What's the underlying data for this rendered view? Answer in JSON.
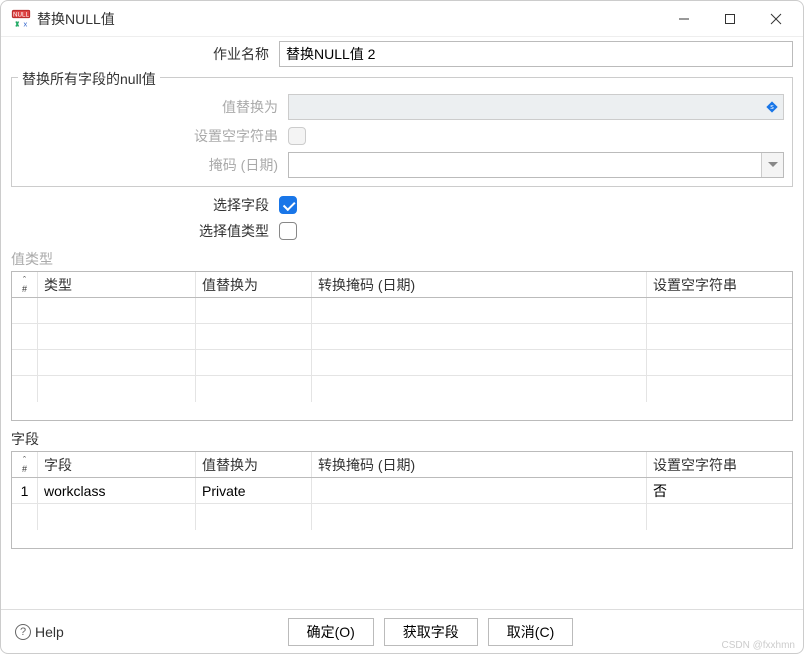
{
  "window": {
    "title": "替换NULL值"
  },
  "form": {
    "job_name_label": "作业名称",
    "job_name_value": "替换NULL值 2"
  },
  "fieldset": {
    "legend": "替换所有字段的null值",
    "replace_value_label": "值替换为",
    "replace_value_value": "",
    "set_empty_string_label": "设置空字符串",
    "date_mask_label": "掩码 (日期)",
    "date_mask_value": ""
  },
  "options": {
    "select_field_label": "选择字段",
    "select_field_checked": true,
    "select_value_type_label": "选择值类型",
    "select_value_type_checked": false
  },
  "value_type_section": {
    "label": "值类型",
    "headers": {
      "hash": "#",
      "type": "类型",
      "replace_as": "值替换为",
      "date_mask": "转换掩码 (日期)",
      "set_empty": "设置空字符串"
    },
    "rows": []
  },
  "field_section": {
    "label": "字段",
    "headers": {
      "hash": "#",
      "field": "字段",
      "replace_as": "值替换为",
      "date_mask": "转换掩码 (日期)",
      "set_empty": "设置空字符串"
    },
    "rows": [
      {
        "num": "1",
        "field": "workclass",
        "replace_as": "Private",
        "date_mask": "",
        "set_empty": "否"
      }
    ]
  },
  "buttons": {
    "help": "Help",
    "ok": "确定(O)",
    "get_fields": "获取字段",
    "cancel": "取消(C)"
  },
  "watermark": "CSDN @fxxhmn"
}
